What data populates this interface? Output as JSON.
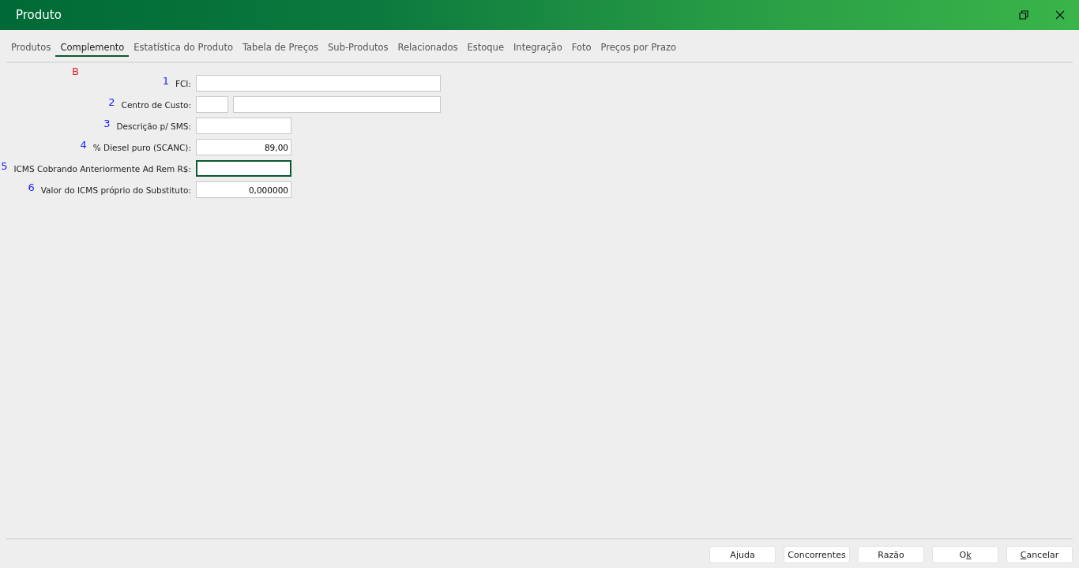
{
  "window": {
    "title": "Produto"
  },
  "tabs": [
    {
      "label": "Produtos",
      "selected": false
    },
    {
      "label": "Complemento",
      "selected": true
    },
    {
      "label": "Estatística do Produto",
      "selected": false
    },
    {
      "label": "Tabela de Preços",
      "selected": false
    },
    {
      "label": "Sub-Produtos",
      "selected": false
    },
    {
      "label": "Relacionados",
      "selected": false
    },
    {
      "label": "Estoque",
      "selected": false
    },
    {
      "label": "Integração",
      "selected": false
    },
    {
      "label": "Foto",
      "selected": false
    },
    {
      "label": "Preços por Prazo",
      "selected": false
    }
  ],
  "tab_annotation": "B",
  "fields": [
    {
      "marker": "1",
      "label": "FCI:",
      "kind": "wide",
      "inputs": [
        {
          "focused": false
        }
      ]
    },
    {
      "marker": "2",
      "label": "Centro de Custo:",
      "kind": "pair",
      "inputs": [
        {
          "focused": false
        },
        {
          "focused": false
        }
      ]
    },
    {
      "marker": "3",
      "label": "Descrição p/ SMS:",
      "kind": "short",
      "inputs": [
        {
          "focused": false
        }
      ]
    },
    {
      "marker": "4",
      "label": "% Diesel puro (SCANC):",
      "kind": "short",
      "inputs": [
        {
          "value": "89,00",
          "focused": false
        }
      ]
    },
    {
      "marker": "5",
      "label": "ICMS Cobrando Anteriormente Ad Rem R$:",
      "kind": "short",
      "inputs": [
        {
          "focused": true
        }
      ]
    },
    {
      "marker": "6",
      "label": "Valor do ICMS próprio do Substituto:",
      "kind": "short",
      "inputs": [
        {
          "value": "0,000000",
          "focused": false
        }
      ]
    }
  ],
  "buttons": [
    {
      "label_parts": [
        {
          "text": "Ajuda",
          "underlined": false
        }
      ]
    },
    {
      "label_parts": [
        {
          "text": "Concorrentes",
          "underlined": false
        }
      ]
    },
    {
      "label_parts": [
        {
          "text": "Razão",
          "underlined": false
        }
      ]
    },
    {
      "label_parts": [
        {
          "text": "O",
          "underlined": false
        },
        {
          "text": "k",
          "underlined": true
        }
      ]
    },
    {
      "label_parts": [
        {
          "text": "C",
          "underlined": true
        },
        {
          "text": "ancelar",
          "underlined": false
        }
      ]
    }
  ]
}
